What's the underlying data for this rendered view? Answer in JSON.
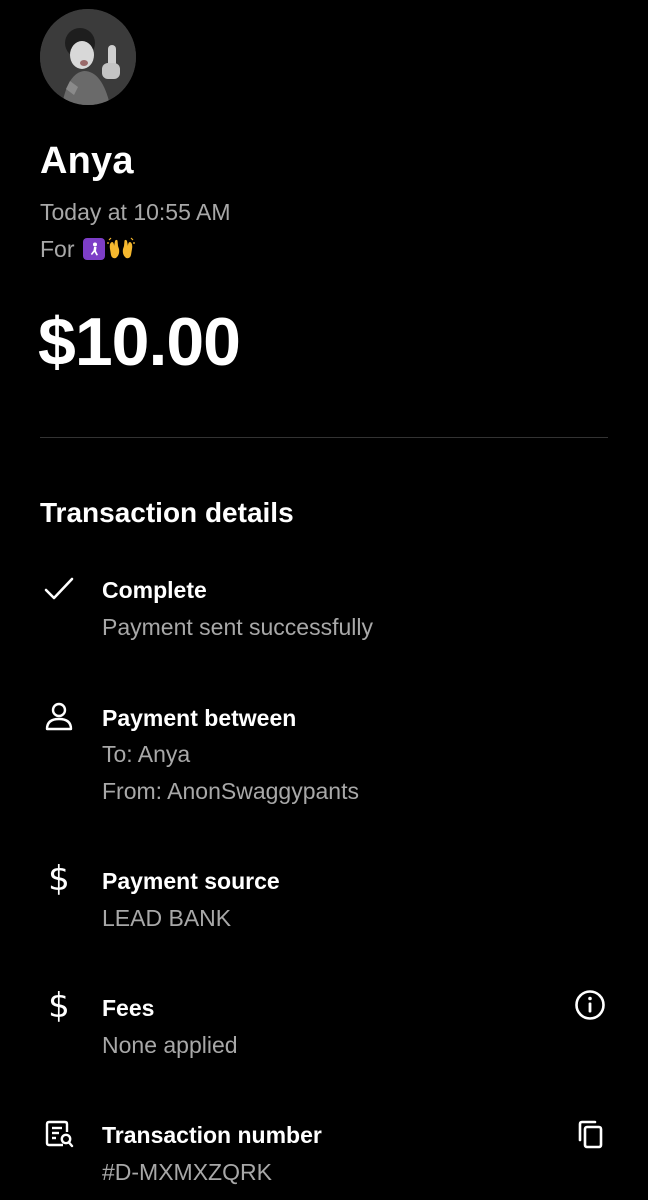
{
  "header": {
    "name": "Anya",
    "timestamp": "Today at 10:55 AM",
    "note_prefix": "For",
    "note_emojis": [
      "emoji-tile-icon",
      "raising-hands-emoji"
    ]
  },
  "amount": "$10.00",
  "details": {
    "title": "Transaction details",
    "status": {
      "icon": "checkmark-icon",
      "title": "Complete",
      "subtitle": "Payment sent successfully"
    },
    "parties": {
      "icon": "person-icon",
      "title": "Payment between",
      "to": "To: Anya",
      "from": "From: AnonSwaggypants"
    },
    "source": {
      "icon": "dollar-icon",
      "dollar_symbol": "$",
      "title": "Payment source",
      "subtitle": "LEAD BANK"
    },
    "fees": {
      "icon": "dollar-icon",
      "dollar_symbol": "$",
      "title": "Fees",
      "subtitle": "None applied",
      "info_icon": "info-icon"
    },
    "transaction": {
      "icon": "receipt-search-icon",
      "title": "Transaction number",
      "subtitle": "#D-MXMXZQRK",
      "copy_icon": "copy-icon"
    }
  },
  "colors": {
    "background": "#000000",
    "primary_text": "#ffffff",
    "secondary_text": "#a8a8a8",
    "divider": "#333333",
    "emoji_tile": "#7d3ec7"
  }
}
